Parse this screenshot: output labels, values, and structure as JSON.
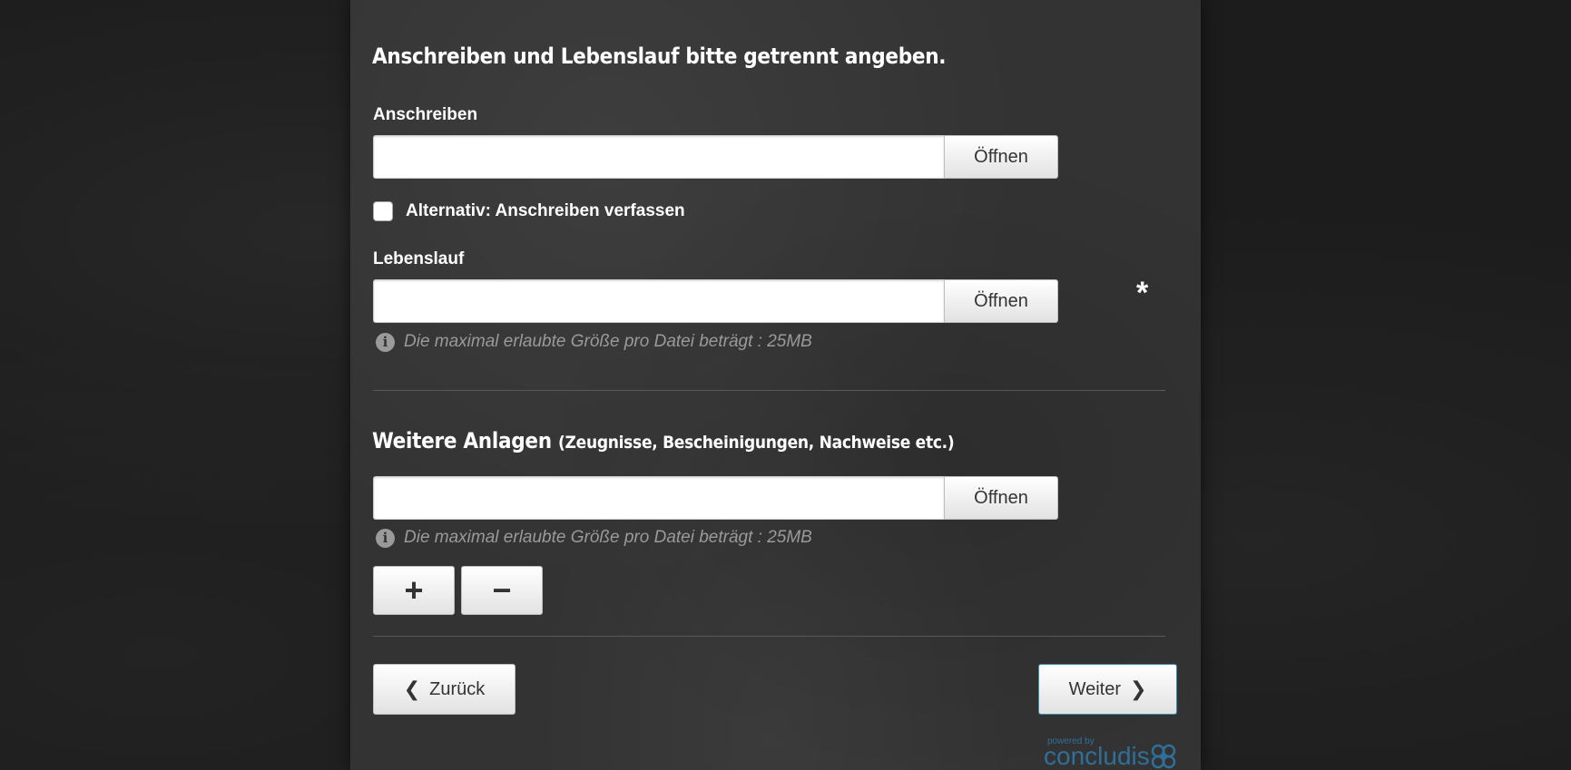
{
  "sections": {
    "documents_heading": "Anschreiben und Lebenslauf bitte getrennt angeben.",
    "attachments_heading": "Weitere Anlagen",
    "attachments_subheading": "(Zeugnisse, Bescheinigungen, Nachweise etc.)"
  },
  "cover_letter": {
    "label": "Anschreiben",
    "value": "",
    "open_label": "Öffnen"
  },
  "alternative": {
    "checked": false,
    "label": "Alternativ: Anschreiben verfassen"
  },
  "cv": {
    "label": "Lebenslauf",
    "value": "",
    "open_label": "Öffnen",
    "required_mark": "*",
    "hint": "Die maximal erlaubte Größe pro Datei beträgt : 25MB"
  },
  "attachments": {
    "value": "",
    "open_label": "Öffnen",
    "hint": "Die maximal erlaubte Größe pro Datei beträgt : 25MB",
    "add_label": "+",
    "remove_label": "−"
  },
  "navigation": {
    "back_label": "Zurück",
    "next_label": "Weiter"
  },
  "icons": {
    "info": "info-circle-icon",
    "back": "chevron-left-icon",
    "next": "chevron-right-icon"
  },
  "brand": {
    "powered_by": "powered by",
    "name": "concludis",
    "color": "#2f6f99"
  },
  "colors": {
    "background": "#1c1c1c",
    "panel": "#333333",
    "hint_text": "#9a9a9a",
    "accent_border": "#3a8fb7"
  }
}
